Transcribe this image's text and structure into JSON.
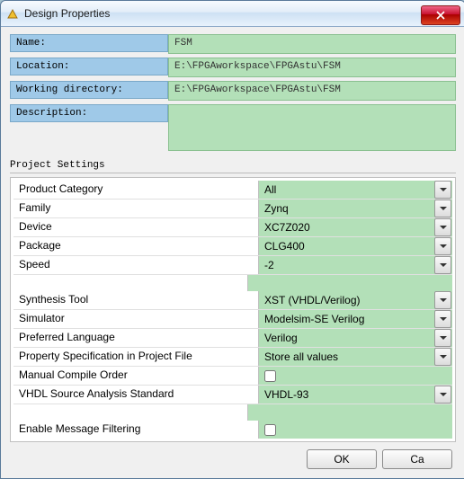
{
  "window": {
    "title": "Design Properties"
  },
  "fields": {
    "name_label": "Name:",
    "name_value": "FSM",
    "location_label": "Location:",
    "location_value": "E:\\FPGAworkspace\\FPGAstu\\FSM",
    "workdir_label": "Working directory:",
    "workdir_value": "E:\\FPGAworkspace\\FPGAstu\\FSM",
    "desc_label": "Description:",
    "desc_value": ""
  },
  "section": "Project Settings",
  "settings": {
    "product_cat_label": "Product Category",
    "product_cat_value": "All",
    "family_label": "Family",
    "family_value": "Zynq",
    "device_label": "Device",
    "device_value": "XC7Z020",
    "package_label": "Package",
    "package_value": "CLG400",
    "speed_label": "Speed",
    "speed_value": "-2",
    "synth_label": "Synthesis Tool",
    "synth_value": "XST (VHDL/Verilog)",
    "sim_label": "Simulator",
    "sim_value": "Modelsim-SE Verilog",
    "lang_label": "Preferred Language",
    "lang_value": "Verilog",
    "propspec_label": "Property Specification in Project File",
    "propspec_value": "Store all values",
    "compile_label": "Manual Compile Order",
    "vhdlstd_label": "VHDL Source Analysis Standard",
    "vhdlstd_value": "VHDL-93",
    "msgfilt_label": "Enable Message Filtering"
  },
  "buttons": {
    "ok": "OK",
    "cancel": "Ca"
  }
}
